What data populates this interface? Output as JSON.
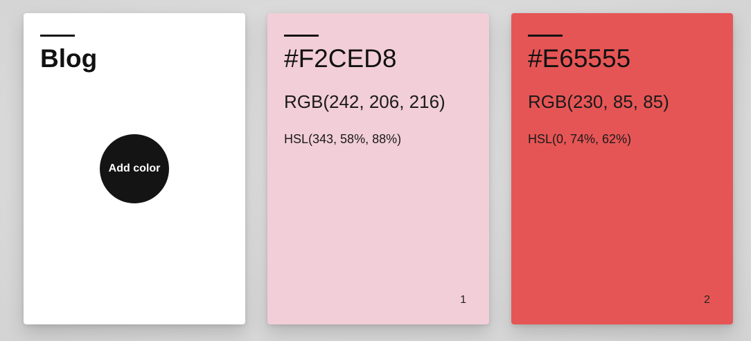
{
  "blog_card": {
    "title": "Blog",
    "add_button_label": "Add color"
  },
  "colors": [
    {
      "hex": "#F2CED8",
      "rgb": "RGB(242, 206, 216)",
      "hsl": "HSL(343, 58%, 88%)",
      "index": "1"
    },
    {
      "hex": "#E65555",
      "rgb": "RGB(230, 85, 85)",
      "hsl": "HSL(0, 74%, 62%)",
      "index": "2"
    }
  ]
}
